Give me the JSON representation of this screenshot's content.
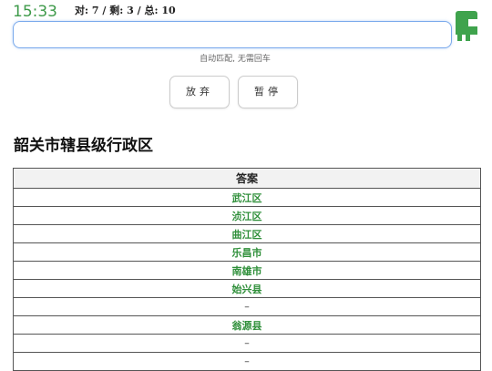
{
  "status": {
    "timer": "15:33",
    "score": "对: 7 / 剩: 3 / 总: 10"
  },
  "input": {
    "value": "",
    "placeholder": ""
  },
  "hint": "自动匹配, 无需回车",
  "buttons": {
    "give_up": "放弃",
    "pause": "暂停"
  },
  "quiz": {
    "title": "韶关市辖县级行政区"
  },
  "table": {
    "header": "答案",
    "rows": [
      "武江区",
      "浈江区",
      "曲江区",
      "乐昌市",
      "南雄市",
      "始兴县",
      "–",
      "翁源县",
      "–",
      "–"
    ]
  },
  "colors": {
    "timer": "#3e9a4a",
    "answer_text": "#2f8f3a",
    "input_border": "#79a9ec"
  }
}
